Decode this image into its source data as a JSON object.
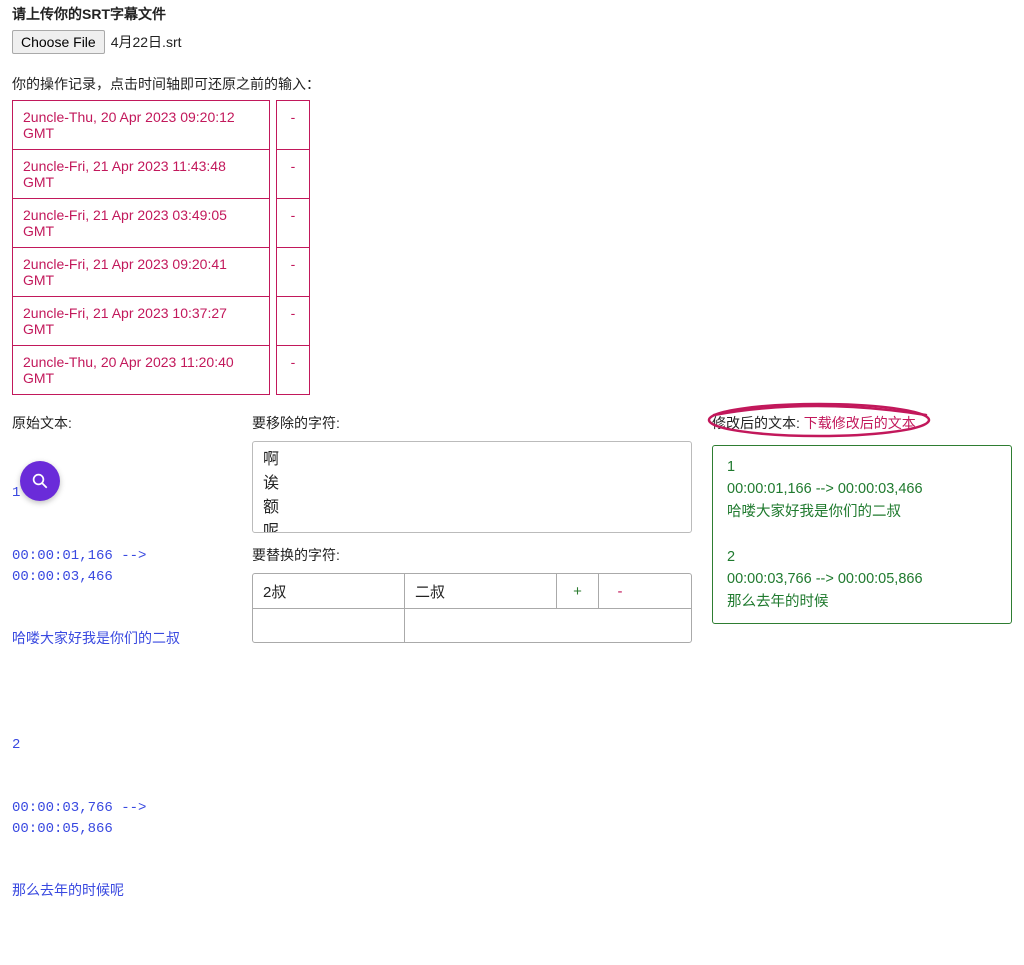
{
  "upload_header": "请上传你的SRT字幕文件",
  "choose_file_label": "Choose File",
  "selected_filename": "4月22日.srt",
  "history_label": "你的操作记录，点击时间轴即可还原之前的输入：",
  "history_items": [
    "2uncle-Thu, 20 Apr 2023 09:20:12 GMT",
    "2uncle-Fri, 21 Apr 2023 11:43:48 GMT",
    "2uncle-Fri, 21 Apr 2023 03:49:05 GMT",
    "2uncle-Fri, 21 Apr 2023 09:20:41 GMT",
    "2uncle-Fri, 21 Apr 2023 10:37:27 GMT",
    "2uncle-Thu, 20 Apr 2023 11:20:40 GMT"
  ],
  "history_delete_symbol": "-",
  "orig_label": "原始文本:",
  "orig_text_1_idx": "1",
  "orig_text_1_time": "00:00:01,166 --> 00:00:03,466",
  "orig_text_1_body": "哈喽大家好我是你们的二叔",
  "orig_text_2_idx": "2",
  "orig_text_2_time": "00:00:03,766 --> 00:00:05,866",
  "orig_text_2_body": "那么去年的时候呢",
  "remove_label": "要移除的字符:",
  "remove_items": [
    "啊",
    "诶",
    "额",
    "呢"
  ],
  "replace_label": "要替换的字符:",
  "replace_row_src": "2叔",
  "replace_row_dst": "二叔",
  "replace_plus": "+",
  "replace_minus": "-",
  "result_label": "修改后的文本: ",
  "download_text": "下载修改后的文本",
  "result_text": "1\n00:00:01,166 --> 00:00:03,466\n哈喽大家好我是你们的二叔\n\n2\n00:00:03,766 --> 00:00:05,866\n那么去年的时候"
}
